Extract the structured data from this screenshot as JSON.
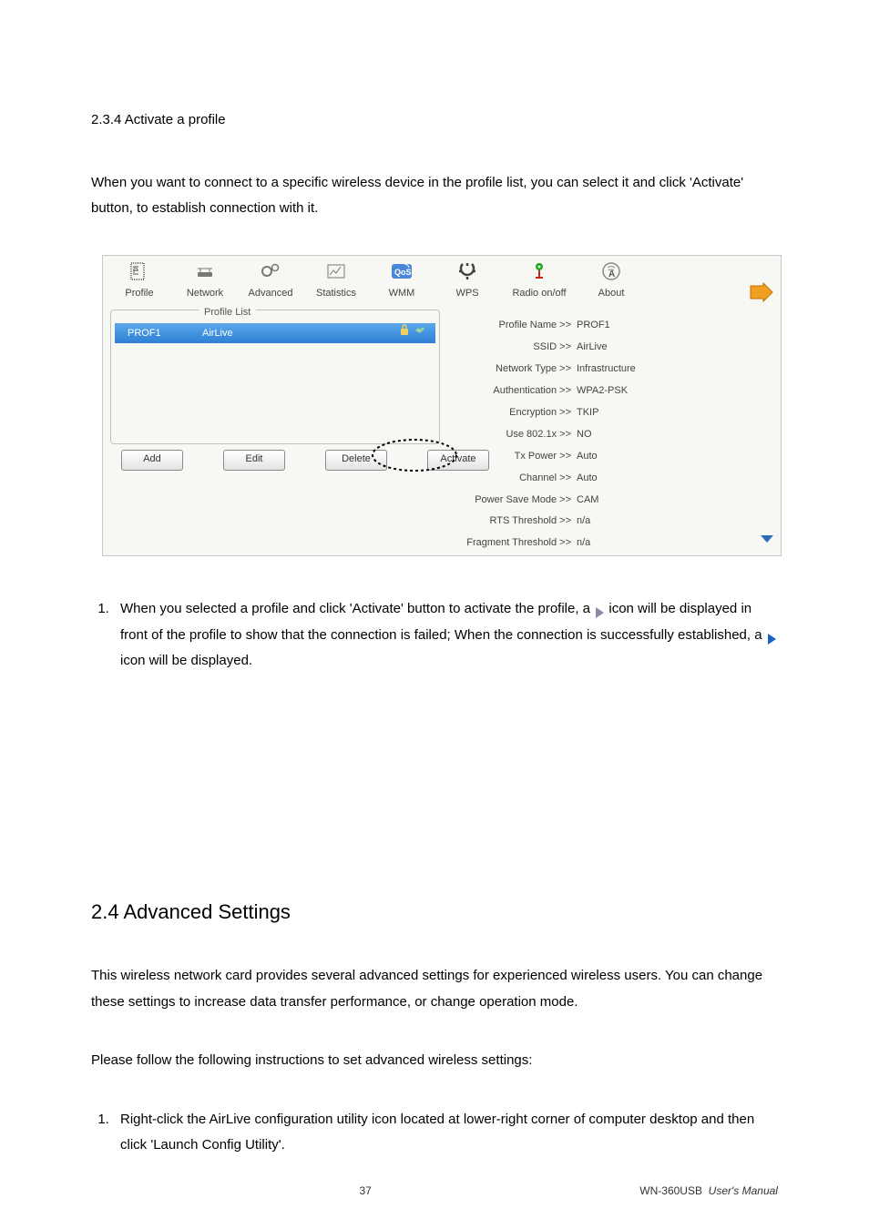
{
  "sections": {
    "s234_title": "2.3.4 Activate a profile",
    "s234_intro": "When you want to connect to a specific wireless device in the profile list, you can select it and click 'Activate' button, to establish connection with it.",
    "s24_title": "2.4 Advanced Settings",
    "s24_p1": "This wireless network card provides several advanced settings for experienced wireless users. You can change these settings to increase data transfer performance, or change operation mode.",
    "s24_p2": "Please follow the following instructions to set advanced wireless settings:",
    "s24_step1": "Right-click the AirLive configuration utility icon located at lower-right corner of computer desktop and then click 'Launch Config Utility'."
  },
  "list1": {
    "pre": "When you selected a profile and click 'Activate' button to activate the profile, a ",
    "mid": " icon will be displayed in front of the profile to show that the connection is failed; When the connection is successfully established, a ",
    "post": " icon will be displayed."
  },
  "toolbar": {
    "profile": "Profile",
    "network": "Network",
    "advanced": "Advanced",
    "statistics": "Statistics",
    "wmm": "WMM",
    "wps": "WPS",
    "radio": "Radio on/off",
    "about": "About"
  },
  "profile_list_legend": "Profile List",
  "selected_profile": {
    "name": "PROF1",
    "ssid": "AirLive"
  },
  "buttons": {
    "add": "Add",
    "edit": "Edit",
    "delete": "Delete",
    "activate": "Activate"
  },
  "detail": {
    "profile_name_k": "Profile Name >>",
    "profile_name_v": "PROF1",
    "ssid_k": "SSID >>",
    "ssid_v": "AirLive",
    "nettype_k": "Network Type >>",
    "nettype_v": "Infrastructure",
    "auth_k": "Authentication >>",
    "auth_v": "WPA2-PSK",
    "enc_k": "Encryption >>",
    "enc_v": "TKIP",
    "dot1x_k": "Use 802.1x >>",
    "dot1x_v": "NO",
    "txpow_k": "Tx Power >>",
    "txpow_v": "Auto",
    "chan_k": "Channel >>",
    "chan_v": "Auto",
    "psm_k": "Power Save Mode >>",
    "psm_v": "CAM",
    "rts_k": "RTS Threshold >>",
    "rts_v": "n/a",
    "frag_k": "Fragment Threshold >>",
    "frag_v": "n/a"
  },
  "footer": {
    "page": "37",
    "manual": "WN-360USB",
    "manual2": "User's Manual"
  }
}
